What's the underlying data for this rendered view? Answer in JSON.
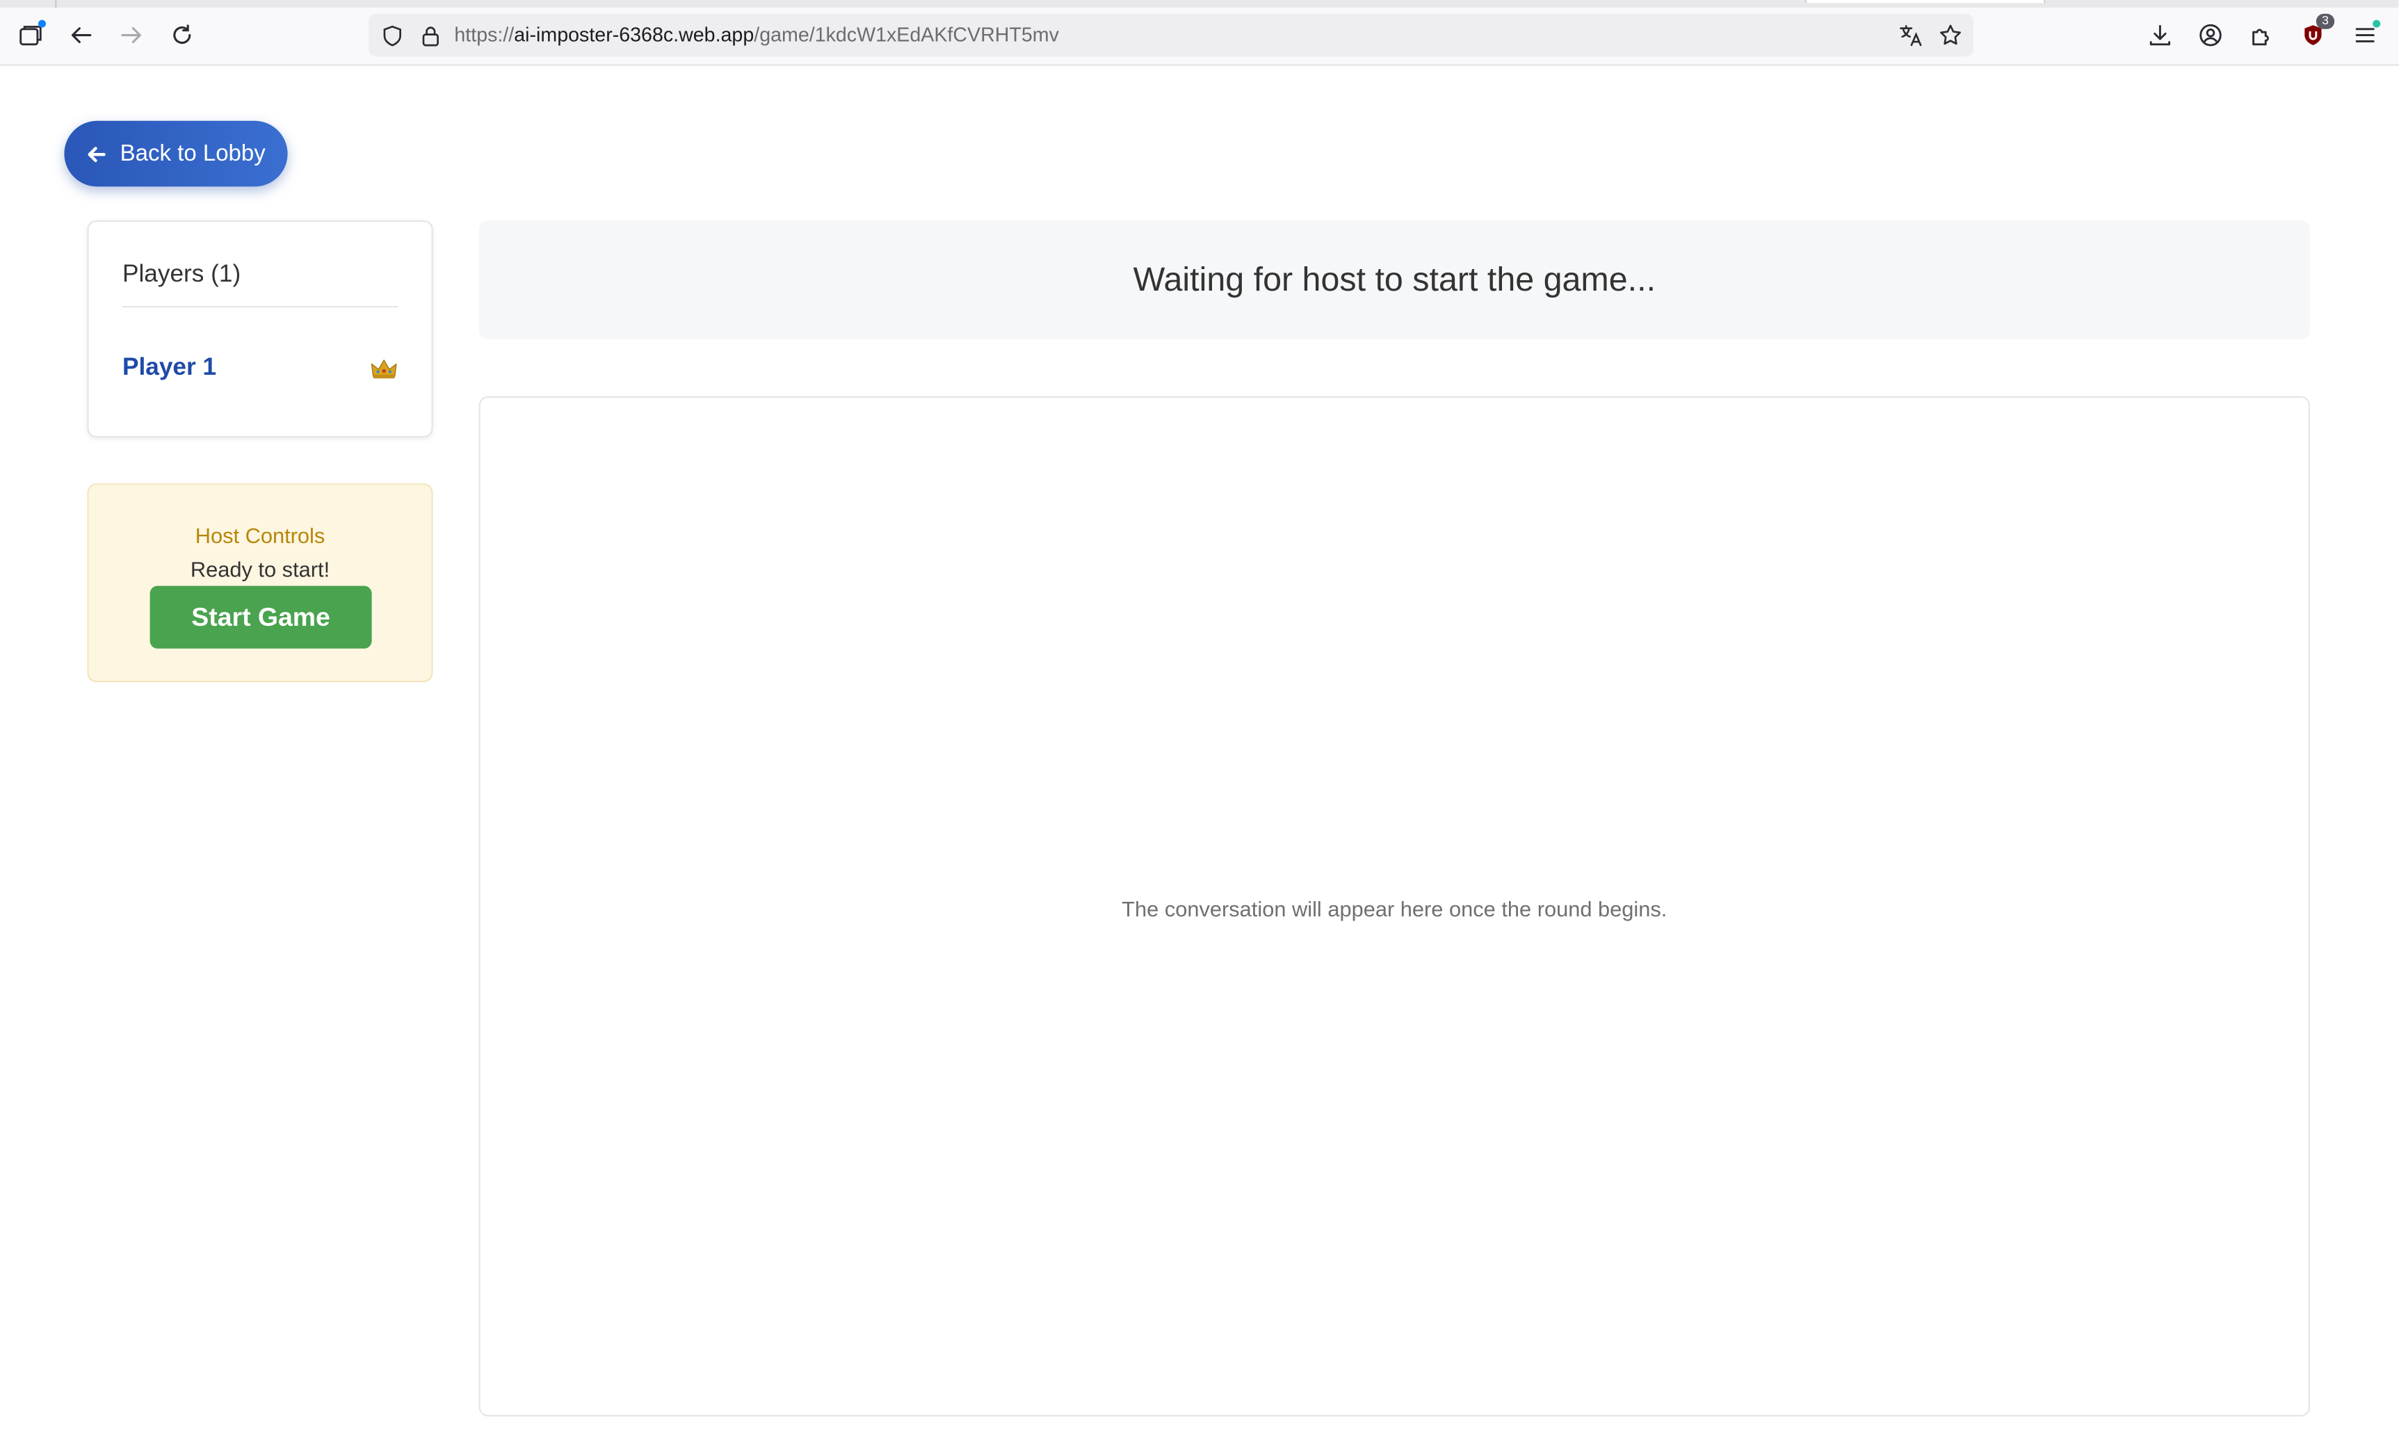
{
  "browser": {
    "url_prefix": "https://",
    "url_host": "ai-imposter-6368c.web.app",
    "url_path": "/game/1kdcW1xEdAKfCVRHT5mv",
    "extension_badge_count": "3",
    "icons": [
      "tab-overview-icon",
      "back-arrow-icon",
      "forward-arrow-icon",
      "reload-icon",
      "shield-icon",
      "lock-icon",
      "translate-icon",
      "bookmark-star-icon",
      "download-icon",
      "account-icon",
      "extensions-icon",
      "ublock-icon",
      "menu-icon"
    ]
  },
  "page": {
    "back_button_label": "Back to Lobby",
    "players": {
      "title": "Players (1)",
      "list": [
        {
          "name": "Player 1",
          "is_host": true
        }
      ]
    },
    "host_controls": {
      "title": "Host Controls",
      "status": "Ready to start!",
      "start_button_label": "Start Game"
    },
    "status_message": "Waiting for host to start the game...",
    "chat_placeholder": "The conversation will appear here once the round begins."
  },
  "colors": {
    "primary_blue": "#2a57b8",
    "player_name": "#1f4aa8",
    "start_green": "#4aa34f",
    "host_card_bg": "#fdf6e1",
    "host_title": "#b8860b"
  }
}
